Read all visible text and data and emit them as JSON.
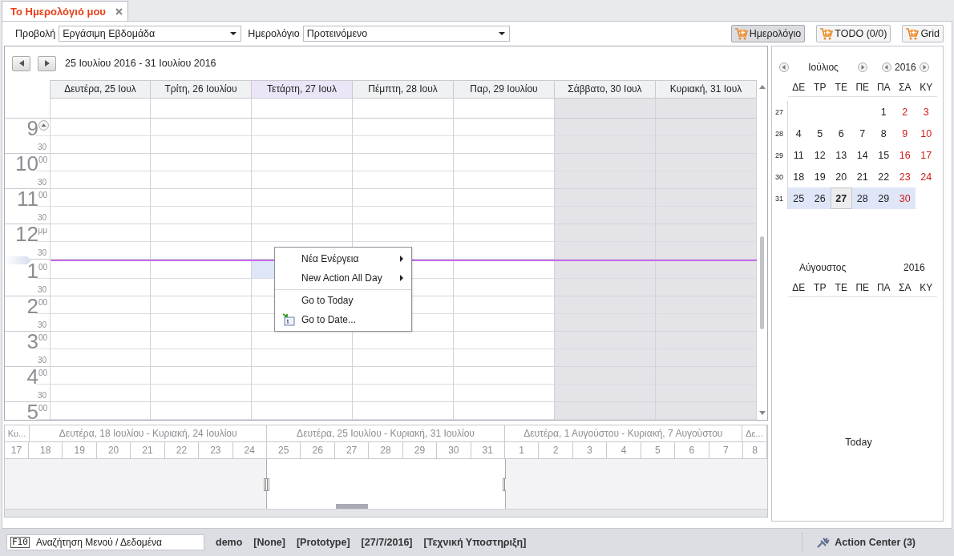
{
  "tab": {
    "title": "Το Ημερολόγιό μου",
    "selected": true
  },
  "toolbar": {
    "view_label": "Προβολή",
    "view_value": "Εργάσιμη Εβδομάδα",
    "calendar_label": "Ημερολόγιο",
    "calendar_value": "Προτεινόμενο",
    "buttons": [
      {
        "label": "Ημερολόγιο",
        "selected": true
      },
      {
        "label": "TODO (0/0)",
        "selected": false
      },
      {
        "label": "Grid",
        "selected": false
      }
    ]
  },
  "scheduler": {
    "range": "25 Ιουλίου 2016 - 31 Ιουλίου 2016",
    "days": [
      {
        "label": "Δευτέρα, 25 Ιουλ",
        "today": false,
        "weekend": false,
        "selected": false
      },
      {
        "label": "Τρίτη, 26 Ιουλίου",
        "today": false,
        "weekend": false,
        "selected": false
      },
      {
        "label": "Τετάρτη, 27 Ιουλ",
        "today": true,
        "weekend": false,
        "selected": true
      },
      {
        "label": "Πέμπτη, 28 Ιουλ",
        "today": false,
        "weekend": false,
        "selected": false
      },
      {
        "label": "Παρ, 29 Ιουλίου",
        "today": false,
        "weekend": false,
        "selected": false
      },
      {
        "label": "Σάββατο, 30 Ιουλ",
        "today": false,
        "weekend": true,
        "selected": false
      },
      {
        "label": "Κυριακή, 31 Ιουλ",
        "today": false,
        "weekend": true,
        "selected": false
      }
    ],
    "hours": [
      {
        "hour": "9",
        "half": "30",
        "scroll_button": true,
        "current": false,
        "selected": false
      },
      {
        "hour": "10",
        "suffix": "00",
        "half": "30",
        "scroll_button": false,
        "current": false,
        "selected": false
      },
      {
        "hour": "11",
        "suffix": "00",
        "half": "30",
        "scroll_button": false,
        "current": false,
        "selected": false
      },
      {
        "hour": "12",
        "suffix": "μμ",
        "half": "30",
        "scroll_button": false,
        "current": false,
        "selected": false
      },
      {
        "hour": "1",
        "suffix": "00",
        "half": "30",
        "scroll_button": false,
        "current": true,
        "selected": true
      },
      {
        "hour": "2",
        "suffix": "00",
        "half": "30",
        "scroll_button": false,
        "current": false,
        "selected": false
      },
      {
        "hour": "3",
        "suffix": "00",
        "half": "30",
        "scroll_button": false,
        "current": false,
        "selected": false
      },
      {
        "hour": "4",
        "suffix": "00",
        "half": "30",
        "scroll_button": false,
        "current": false,
        "selected": false
      },
      {
        "hour": "5",
        "suffix": "00",
        "scroll_button": false,
        "current": false,
        "selected": false
      }
    ],
    "context_menu": [
      {
        "label": "Νέα Ενέργεια",
        "kind": "submenu",
        "separator_before": false
      },
      {
        "label": "New Action All Day",
        "kind": "submenu",
        "separator_before": false
      },
      {
        "label": "Go to Today",
        "kind": "action",
        "separator_before": true
      },
      {
        "label": "Go to Date...",
        "kind": "date",
        "separator_before": false
      }
    ]
  },
  "timeline": {
    "weeks": [
      {
        "label": "Κυ...",
        "selected": false,
        "days": [
          "17"
        ]
      },
      {
        "label": "Δευτέρα, 18 Ιουλίου - Κυριακή, 24 Ιουλίου",
        "selected": false,
        "days": [
          "18",
          "19",
          "20",
          "21",
          "22",
          "23",
          "24"
        ]
      },
      {
        "label": "Δευτέρα, 25 Ιουλίου - Κυριακή, 31 Ιουλίου",
        "selected": true,
        "days": [
          "25",
          "26",
          "27",
          "28",
          "29",
          "30",
          "31"
        ]
      },
      {
        "label": "Δευτέρα, 1 Αυγούστου - Κυριακή, 7 Αυγούστου",
        "selected": false,
        "days": [
          "1",
          "2",
          "3",
          "4",
          "5",
          "6",
          "7"
        ]
      },
      {
        "label": "Δε...",
        "selected": false,
        "days": [
          "8"
        ]
      }
    ]
  },
  "date_navigator": {
    "months": [
      {
        "month": "Ιούλιος",
        "year": "2016",
        "nav": true,
        "weekdays": [
          "ΔΕ",
          "ΤΡ",
          "ΤΕ",
          "ΠΕ",
          "ΠΑ",
          "ΣΑ",
          "ΚΥ"
        ],
        "weeks": [
          {
            "number": "27",
            "days": [
              {
                "kind": "blank"
              },
              {
                "kind": "blank"
              },
              {
                "kind": "blank"
              },
              {
                "kind": "blank"
              },
              {
                "kind": "day",
                "label": "1",
                "selected": false,
                "today": false
              },
              {
                "kind": "day",
                "label": "2",
                "selected": false,
                "today": false
              },
              {
                "kind": "day",
                "label": "3",
                "selected": false,
                "today": false
              }
            ]
          },
          {
            "number": "28",
            "days": [
              {
                "kind": "day",
                "label": "4",
                "selected": false,
                "today": false
              },
              {
                "kind": "day",
                "label": "5",
                "selected": false,
                "today": false
              },
              {
                "kind": "day",
                "label": "6",
                "selected": false,
                "today": false
              },
              {
                "kind": "day",
                "label": "7",
                "selected": false,
                "today": false
              },
              {
                "kind": "day",
                "label": "8",
                "selected": false,
                "today": false
              },
              {
                "kind": "day",
                "label": "9",
                "selected": false,
                "today": false
              },
              {
                "kind": "day",
                "label": "10",
                "selected": false,
                "today": false
              }
            ]
          },
          {
            "number": "29",
            "days": [
              {
                "kind": "day",
                "label": "11",
                "selected": false,
                "today": false
              },
              {
                "kind": "day",
                "label": "12",
                "selected": false,
                "today": false
              },
              {
                "kind": "day",
                "label": "13",
                "selected": false,
                "today": false
              },
              {
                "kind": "day",
                "label": "14",
                "selected": false,
                "today": false
              },
              {
                "kind": "day",
                "label": "15",
                "selected": false,
                "today": false
              },
              {
                "kind": "day",
                "label": "16",
                "selected": false,
                "today": false
              },
              {
                "kind": "day",
                "label": "17",
                "selected": false,
                "today": false
              }
            ]
          },
          {
            "number": "30",
            "days": [
              {
                "kind": "day",
                "label": "18",
                "selected": false,
                "today": false
              },
              {
                "kind": "day",
                "label": "19",
                "selected": false,
                "today": false
              },
              {
                "kind": "day",
                "label": "20",
                "selected": false,
                "today": false
              },
              {
                "kind": "day",
                "label": "21",
                "selected": false,
                "today": false
              },
              {
                "kind": "day",
                "label": "22",
                "selected": false,
                "today": false
              },
              {
                "kind": "day",
                "label": "23",
                "selected": false,
                "today": false
              },
              {
                "kind": "day",
                "label": "24",
                "selected": false,
                "today": false
              }
            ]
          },
          {
            "number": "31",
            "days": [
              {
                "kind": "day",
                "label": "25",
                "selected": true,
                "today": false
              },
              {
                "kind": "day",
                "label": "26",
                "selected": true,
                "today": false
              },
              {
                "kind": "day",
                "label": "27",
                "selected": true,
                "today": true
              },
              {
                "kind": "day",
                "label": "28",
                "selected": true,
                "today": false
              },
              {
                "kind": "day",
                "label": "29",
                "selected": true,
                "today": false
              },
              {
                "kind": "day",
                "label": "30",
                "selected": true,
                "today": false
              },
              {
                "kind": "blank"
              }
            ]
          }
        ]
      },
      {
        "month": "Αύγουστος",
        "year": "2016",
        "nav": false,
        "weekdays": [
          "ΔΕ",
          "ΤΡ",
          "ΤΕ",
          "ΠΕ",
          "ΠΑ",
          "ΣΑ",
          "ΚΥ"
        ]
      }
    ],
    "today_button": "Today"
  },
  "status_bar": {
    "search_key": "F10",
    "search_placeholder": "Αναζήτηση Μενού / Δεδομένα",
    "items": [
      "demo",
      "[None]",
      "[Prototype]",
      "[27/7/2016]",
      "[Τεχνική Υποστηριξη]"
    ],
    "action_center": "Action Center (3)"
  }
}
